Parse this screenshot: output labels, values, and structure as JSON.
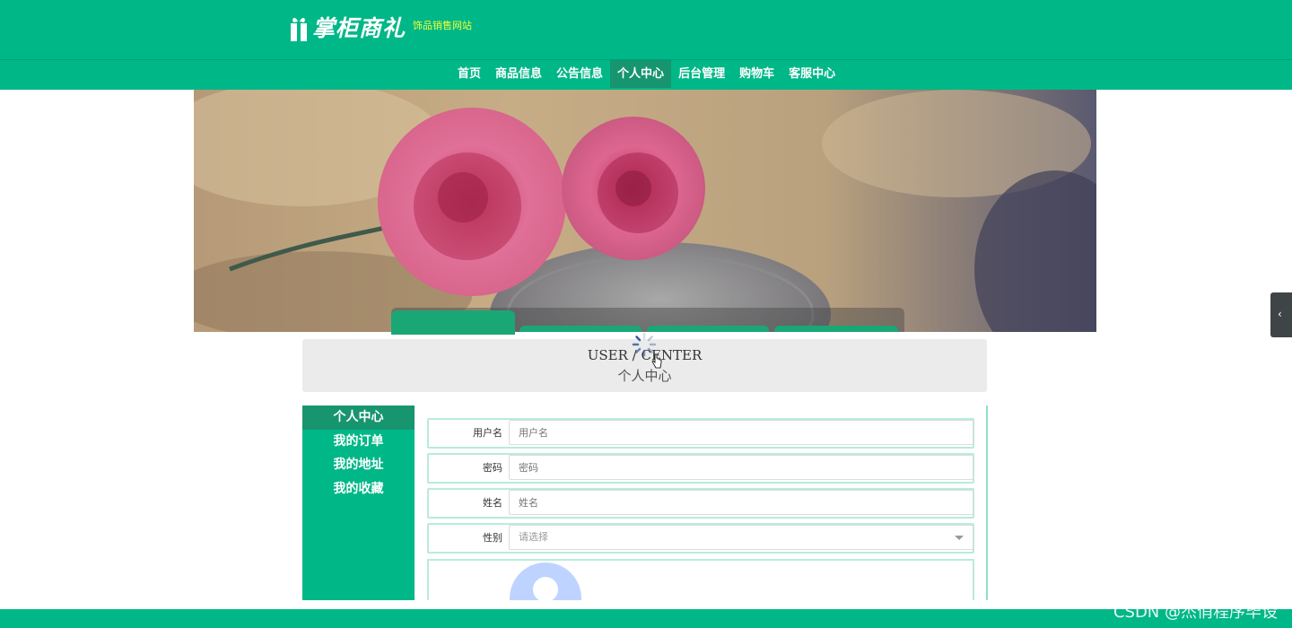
{
  "site": {
    "logo_text": "掌柜商礼",
    "subtitle": "饰品销售网站"
  },
  "nav": {
    "items": [
      "首页",
      "商品信息",
      "公告信息",
      "个人中心",
      "后台管理",
      "购物车",
      "客服中心"
    ],
    "active_index": 3
  },
  "page_title": {
    "en": "USER / CENTER",
    "cn": "个人中心"
  },
  "sidebar": {
    "items": [
      "个人中心",
      "我的订单",
      "我的地址",
      "我的收藏"
    ],
    "active_index": 0
  },
  "form": {
    "username": {
      "label": "用户名",
      "placeholder": "用户名"
    },
    "password": {
      "label": "密码",
      "placeholder": "密码"
    },
    "name": {
      "label": "姓名",
      "placeholder": "姓名"
    },
    "gender": {
      "label": "性别",
      "value": "请选择"
    }
  },
  "watermark": "CSDN @杰俏程序毕设",
  "colors": {
    "brand": "#00b787",
    "active": "#17956f",
    "subtitle": "#f4ff3a"
  },
  "icons": {
    "loading": "spinner-icon",
    "collapse": "chevron-left-icon",
    "avatar": "user-avatar-icon"
  }
}
